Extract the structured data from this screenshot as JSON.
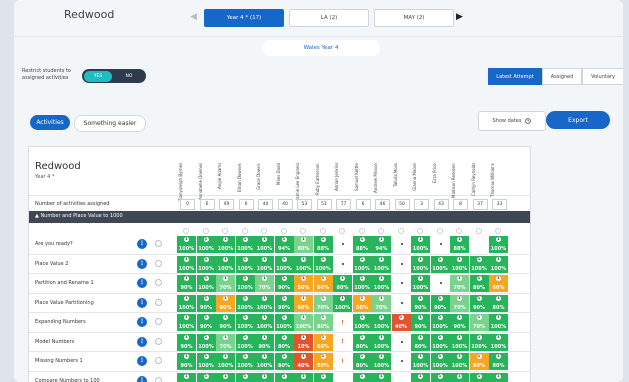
{
  "header": {
    "school": "Redwood",
    "tabs": [
      "Year 4 * (17)",
      "LA (2)",
      "MAY (2)"
    ],
    "active_tab": 0,
    "prev_icon": "triangle-left-icon",
    "next_icon": "triangle-right-icon"
  },
  "curriculum_label": "Wales Year 4",
  "restrict": {
    "label": "Restrict students to assigned activities",
    "yes": "YES",
    "no": "NO"
  },
  "view_buttons": [
    "Latest Attempt",
    "Assigned",
    "Voluntary"
  ],
  "filters": {
    "activities": "Activities",
    "easier": "Something easier"
  },
  "show_dates": "Show dates",
  "export": "Export",
  "table": {
    "class_name": "Redwood",
    "class_sub": "Year 4 *",
    "activities_count_label": "Number of activities assigned",
    "students": [
      "Tianyuleigh Byrnes",
      "Annabelle Downes",
      "Angie Adams",
      "Ethan Downes",
      "Grace Downs",
      "Miles Dodd",
      "Jamie Lee England",
      "Ruby Eatherson",
      "Adrian Jenkins",
      "Samuel Kettle",
      "Andrew Misson",
      "Tallula Moss",
      "Gianna Moore",
      "Ezra Price",
      "Madison Reorden",
      "Caitlyn Reynolds",
      "Thomas Williams"
    ],
    "counts": [
      "0",
      "6",
      "49",
      "6",
      "44",
      "40",
      "53",
      "51",
      "77",
      "6",
      "46",
      "50",
      "3",
      "43",
      "8",
      "37",
      "33"
    ],
    "group": "Number and Place Value to 1000",
    "rows": [
      {
        "label": "Are you ready?",
        "cells": [
          {
            "v": "100%",
            "c": "g",
            "n": "1"
          },
          {
            "v": "100%",
            "c": "g",
            "n": "1"
          },
          {
            "v": "100%",
            "c": "g",
            "n": "1"
          },
          {
            "v": "100%",
            "c": "g",
            "n": "1"
          },
          {
            "v": "100%",
            "c": "g",
            "n": "1"
          },
          {
            "v": "94%",
            "c": "g",
            "n": "1"
          },
          {
            "v": "80%",
            "c": "lg",
            "n": "1"
          },
          {
            "v": "88%",
            "c": "g",
            "n": "1"
          },
          {
            "v": "",
            "c": "w",
            "n": "•"
          },
          {
            "v": "88%",
            "c": "g",
            "n": "1"
          },
          {
            "v": "94%",
            "c": "g",
            "n": "1"
          },
          {
            "v": "",
            "c": "w",
            "n": "•"
          },
          {
            "v": "100%",
            "c": "g",
            "n": "1"
          },
          {
            "v": "",
            "c": "w",
            "n": "•"
          },
          {
            "v": "88%",
            "c": "g",
            "n": "1"
          },
          {
            "v": "",
            "c": "w",
            "n": ""
          },
          {
            "v": "100%",
            "c": "g",
            "n": "1"
          }
        ]
      },
      {
        "label": "Place Value 2",
        "cells": [
          {
            "v": "100%",
            "c": "g",
            "n": "1"
          },
          {
            "v": "100%",
            "c": "g",
            "n": "1"
          },
          {
            "v": "100%",
            "c": "g",
            "n": "1"
          },
          {
            "v": "100%",
            "c": "g",
            "n": "1"
          },
          {
            "v": "100%",
            "c": "g",
            "n": "1"
          },
          {
            "v": "100%",
            "c": "g",
            "n": "1"
          },
          {
            "v": "100%",
            "c": "g",
            "n": "1"
          },
          {
            "v": "100%",
            "c": "g",
            "n": "1"
          },
          {
            "v": "",
            "c": "w",
            "n": "•"
          },
          {
            "v": "100%",
            "c": "g",
            "n": "1"
          },
          {
            "v": "100%",
            "c": "g",
            "n": "1"
          },
          {
            "v": "",
            "c": "w",
            "n": "•"
          },
          {
            "v": "100%",
            "c": "g",
            "n": "1"
          },
          {
            "v": "100%",
            "c": "g",
            "n": "1"
          },
          {
            "v": "100%",
            "c": "g",
            "n": "1"
          },
          {
            "v": "100%",
            "c": "g",
            "n": "1"
          },
          {
            "v": "100%",
            "c": "g",
            "n": "1"
          }
        ]
      },
      {
        "label": "Partition and Rename 1",
        "cells": [
          {
            "v": "90%",
            "c": "g",
            "n": "1"
          },
          {
            "v": "100%",
            "c": "g",
            "n": "1"
          },
          {
            "v": "70%",
            "c": "lg",
            "n": "1"
          },
          {
            "v": "100%",
            "c": "g",
            "n": "1"
          },
          {
            "v": "70%",
            "c": "lg",
            "n": "1"
          },
          {
            "v": "90%",
            "c": "g",
            "n": "1"
          },
          {
            "v": "50%",
            "c": "o",
            "n": "1"
          },
          {
            "v": "60%",
            "c": "o",
            "n": "1"
          },
          {
            "v": "80%",
            "c": "g",
            "n": "1"
          },
          {
            "v": "100%",
            "c": "g",
            "n": "1"
          },
          {
            "v": "100%",
            "c": "g",
            "n": "1"
          },
          {
            "v": "",
            "c": "w",
            "n": "•"
          },
          {
            "v": "100%",
            "c": "g",
            "n": "1"
          },
          {
            "v": "",
            "c": "w",
            "n": "•"
          },
          {
            "v": "70%",
            "c": "lg",
            "n": "1"
          },
          {
            "v": "80%",
            "c": "g",
            "n": "1"
          },
          {
            "v": "60%",
            "c": "o",
            "n": "1"
          }
        ]
      },
      {
        "label": "Place Value Partitioning",
        "cells": [
          {
            "v": "100%",
            "c": "g",
            "n": "1"
          },
          {
            "v": "90%",
            "c": "g",
            "n": "1"
          },
          {
            "v": "90%",
            "c": "o",
            "n": "1"
          },
          {
            "v": "100%",
            "c": "g",
            "n": "1"
          },
          {
            "v": "100%",
            "c": "g",
            "n": "1"
          },
          {
            "v": "90%",
            "c": "g",
            "n": "1"
          },
          {
            "v": "60%",
            "c": "o",
            "n": "1"
          },
          {
            "v": "70%",
            "c": "lg",
            "n": "1"
          },
          {
            "v": "100%",
            "c": "g",
            "n": "1"
          },
          {
            "v": "50%",
            "c": "o",
            "n": "1"
          },
          {
            "v": "70%",
            "c": "lg",
            "n": "1"
          },
          {
            "v": "",
            "c": "w",
            "n": "•"
          },
          {
            "v": "90%",
            "c": "g",
            "n": "1"
          },
          {
            "v": "90%",
            "c": "g",
            "n": "1"
          },
          {
            "v": "70%",
            "c": "lg",
            "n": "1"
          },
          {
            "v": "90%",
            "c": "g",
            "n": "1"
          },
          {
            "v": "80%",
            "c": "g",
            "n": "1"
          }
        ]
      },
      {
        "label": "Expanding Numbers",
        "cells": [
          {
            "v": "100%",
            "c": "g",
            "n": "1"
          },
          {
            "v": "90%",
            "c": "g",
            "n": "1"
          },
          {
            "v": "90%",
            "c": "g",
            "n": "1"
          },
          {
            "v": "100%",
            "c": "g",
            "n": "1"
          },
          {
            "v": "100%",
            "c": "g",
            "n": "1"
          },
          {
            "v": "100%",
            "c": "g",
            "n": "1"
          },
          {
            "v": "100%",
            "c": "lg",
            "n": "1"
          },
          {
            "v": "80%",
            "c": "lg",
            "n": "1"
          },
          {
            "v": "!",
            "c": "w",
            "n": ""
          },
          {
            "v": "100%",
            "c": "g",
            "n": "1"
          },
          {
            "v": "100%",
            "c": "g",
            "n": "1"
          },
          {
            "v": "40%",
            "c": "r",
            "n": "1"
          },
          {
            "v": "90%",
            "c": "g",
            "n": "1"
          },
          {
            "v": "100%",
            "c": "g",
            "n": "1"
          },
          {
            "v": "90%",
            "c": "g",
            "n": "1"
          },
          {
            "v": "70%",
            "c": "lg",
            "n": "1"
          },
          {
            "v": "100%",
            "c": "g",
            "n": "1"
          }
        ]
      },
      {
        "label": "Model Numbers",
        "cells": [
          {
            "v": "90%",
            "c": "g",
            "n": "1"
          },
          {
            "v": "100%",
            "c": "g",
            "n": "1"
          },
          {
            "v": "70%",
            "c": "lg",
            "n": "1"
          },
          {
            "v": "100%",
            "c": "g",
            "n": "1"
          },
          {
            "v": "80%",
            "c": "g",
            "n": "1"
          },
          {
            "v": "80%",
            "c": "g",
            "n": "1"
          },
          {
            "v": "10%",
            "c": "r",
            "n": "1"
          },
          {
            "v": "60%",
            "c": "o",
            "n": "1"
          },
          {
            "v": "!",
            "c": "w",
            "n": ""
          },
          {
            "v": "80%",
            "c": "g",
            "n": "1"
          },
          {
            "v": "100%",
            "c": "g",
            "n": "1"
          },
          {
            "v": "",
            "c": "w",
            "n": "•"
          },
          {
            "v": "80%",
            "c": "g",
            "n": "1"
          },
          {
            "v": "100%",
            "c": "g",
            "n": "1"
          },
          {
            "v": "100%",
            "c": "g",
            "n": "1"
          },
          {
            "v": "100%",
            "c": "g",
            "n": "1"
          },
          {
            "v": "100%",
            "c": "g",
            "n": "1"
          }
        ]
      },
      {
        "label": "Missing Numbers 1",
        "cells": [
          {
            "v": "90%",
            "c": "g",
            "n": "1"
          },
          {
            "v": "100%",
            "c": "g",
            "n": "1"
          },
          {
            "v": "100%",
            "c": "g",
            "n": "1"
          },
          {
            "v": "100%",
            "c": "g",
            "n": "1"
          },
          {
            "v": "100%",
            "c": "g",
            "n": "1"
          },
          {
            "v": "80%",
            "c": "g",
            "n": "1"
          },
          {
            "v": "40%",
            "c": "r",
            "n": "1"
          },
          {
            "v": "50%",
            "c": "o",
            "n": "1"
          },
          {
            "v": "!",
            "c": "w",
            "n": ""
          },
          {
            "v": "80%",
            "c": "g",
            "n": "1"
          },
          {
            "v": "100%",
            "c": "g",
            "n": "1"
          },
          {
            "v": "",
            "c": "w",
            "n": "•"
          },
          {
            "v": "100%",
            "c": "g",
            "n": "1"
          },
          {
            "v": "100%",
            "c": "g",
            "n": "1"
          },
          {
            "v": "100%",
            "c": "g",
            "n": "1"
          },
          {
            "v": "60%",
            "c": "o",
            "n": "1"
          },
          {
            "v": "80%",
            "c": "g",
            "n": "1"
          }
        ]
      },
      {
        "label": "Compare Numbers to 100",
        "cells": [
          {
            "v": "",
            "c": "g",
            "n": "1"
          },
          {
            "v": "",
            "c": "g",
            "n": "1"
          },
          {
            "v": "",
            "c": "g",
            "n": "1"
          },
          {
            "v": "",
            "c": "g",
            "n": "1"
          },
          {
            "v": "",
            "c": "g",
            "n": "1"
          },
          {
            "v": "",
            "c": "g",
            "n": "1"
          },
          {
            "v": "",
            "c": "g",
            "n": "1"
          },
          {
            "v": "",
            "c": "g",
            "n": "1"
          },
          {
            "v": "",
            "c": "w",
            "n": ""
          },
          {
            "v": "",
            "c": "g",
            "n": "1"
          },
          {
            "v": "",
            "c": "g",
            "n": "1"
          },
          {
            "v": "",
            "c": "w",
            "n": ""
          },
          {
            "v": "",
            "c": "g",
            "n": "1"
          },
          {
            "v": "",
            "c": "g",
            "n": "1"
          },
          {
            "v": "",
            "c": "g",
            "n": "1"
          },
          {
            "v": "",
            "c": "g",
            "n": "1"
          },
          {
            "v": "",
            "c": "g",
            "n": "1"
          }
        ]
      }
    ]
  },
  "colors": {
    "primary": "#1667c8",
    "g": "#27b45a",
    "lg": "#7bd28f",
    "o": "#f5a623",
    "r": "#e0542f",
    "w": "#ffffff"
  }
}
